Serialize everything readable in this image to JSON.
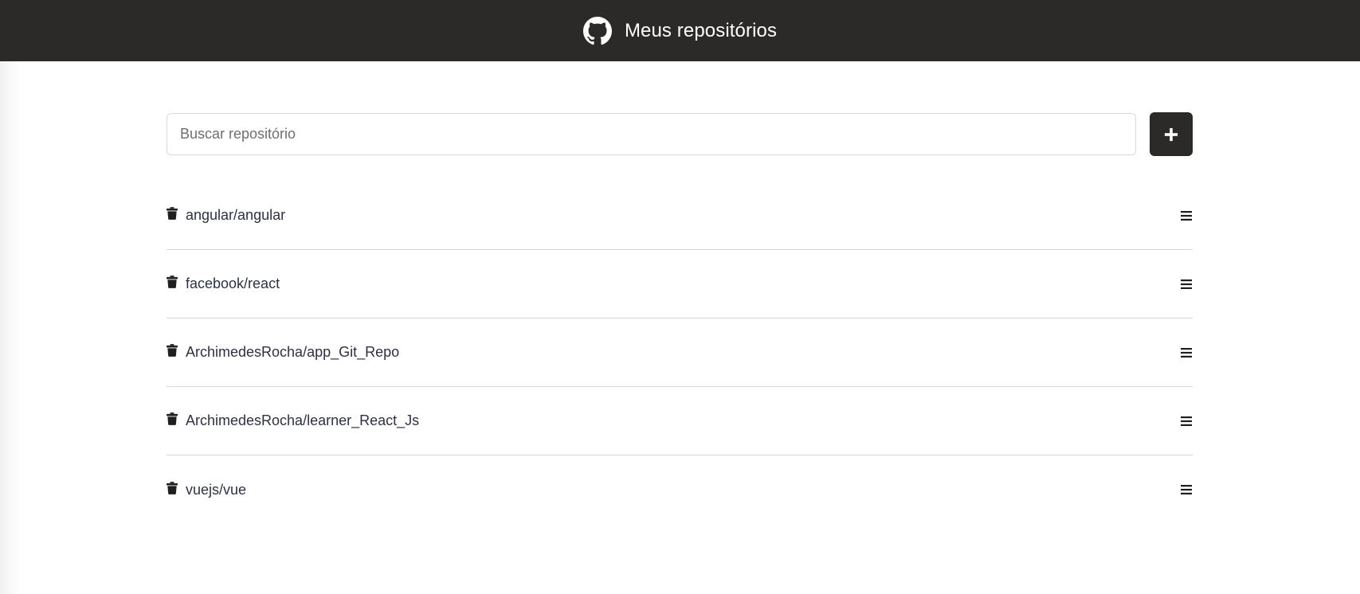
{
  "header": {
    "title": "Meus repositórios",
    "logo_icon": "github-icon",
    "background": "#2b2a28"
  },
  "search": {
    "placeholder": "Buscar repositório",
    "value": "",
    "add_icon": "plus-icon"
  },
  "repositories": [
    {
      "name": "angular/angular",
      "delete_icon": "trash-icon",
      "menu_icon": "hamburger-icon"
    },
    {
      "name": "facebook/react",
      "delete_icon": "trash-icon",
      "menu_icon": "hamburger-icon"
    },
    {
      "name": "ArchimedesRocha/app_Git_Repo",
      "delete_icon": "trash-icon",
      "menu_icon": "hamburger-icon"
    },
    {
      "name": "ArchimedesRocha/learner_React_Js",
      "delete_icon": "trash-icon",
      "menu_icon": "hamburger-icon"
    },
    {
      "name": "vuejs/vue",
      "delete_icon": "trash-icon",
      "menu_icon": "hamburger-icon"
    }
  ],
  "colors": {
    "accent": "#2b2a28",
    "text": "#2d3142",
    "divider": "#d6d6d6"
  }
}
